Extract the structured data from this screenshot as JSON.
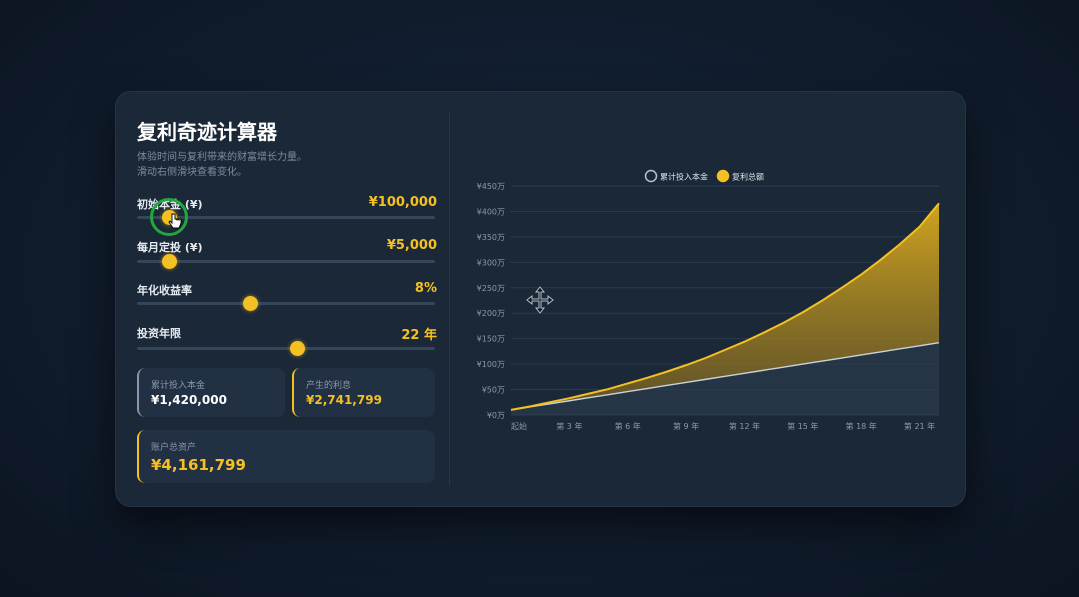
{
  "app": {
    "title": "复利奇迹计算器",
    "desc_line1": "体验时间与复利带来的财富增长力量。",
    "desc_line2": "滑动右侧滑块查看变化。"
  },
  "sliders": [
    {
      "label": "初始本金 (¥)",
      "value_text": "¥100,000",
      "position": 0.11
    },
    {
      "label": "每月定投 (¥)",
      "value_text": "¥5,000",
      "position": 0.11
    },
    {
      "label": "年化收益率",
      "value_text": "8%",
      "position": 0.38
    },
    {
      "label": "投资年限",
      "value_text": "22 年",
      "position": 0.54
    }
  ],
  "stats": {
    "principal": {
      "label": "累计投入本金",
      "value": "¥1,420,000"
    },
    "interest": {
      "label": "产生的利息",
      "value": "¥2,741,799"
    },
    "total": {
      "label": "账户总资产",
      "value": "¥4,161,799"
    }
  },
  "colors": {
    "accent": "#f5c022",
    "principal_line": "#c9d2dc",
    "text_muted": "#8a98a9"
  },
  "chart_data": {
    "type": "area",
    "legend": [
      "累计投入本金",
      "复利总额"
    ],
    "legend_position": "top-center",
    "y_ticks": [
      "¥0万",
      "¥50万",
      "¥100万",
      "¥150万",
      "¥200万",
      "¥250万",
      "¥300万",
      "¥350万",
      "¥400万",
      "¥450万"
    ],
    "x_ticks": [
      "起始",
      "第 3 年",
      "第 6 年",
      "第 9 年",
      "第 12 年",
      "第 15 年",
      "第 18 年",
      "第 21 年"
    ],
    "ylim": [
      0,
      450
    ],
    "x": [
      0,
      1,
      2,
      3,
      4,
      5,
      6,
      7,
      8,
      9,
      10,
      11,
      12,
      13,
      14,
      15,
      16,
      17,
      18,
      19,
      20,
      21,
      22
    ],
    "series": [
      {
        "name": "累计投入本金",
        "values": [
          10,
          16,
          22,
          28,
          34,
          40,
          46,
          52,
          58,
          64,
          70,
          76,
          82,
          88,
          94,
          100,
          106,
          112,
          118,
          124,
          130,
          136,
          142
        ]
      },
      {
        "name": "复利总额",
        "values": [
          10,
          17,
          25,
          33,
          42,
          51,
          62,
          73,
          85,
          98,
          112,
          128,
          144,
          162,
          181,
          202,
          225,
          250,
          276,
          305,
          336,
          370,
          416
        ]
      }
    ]
  }
}
